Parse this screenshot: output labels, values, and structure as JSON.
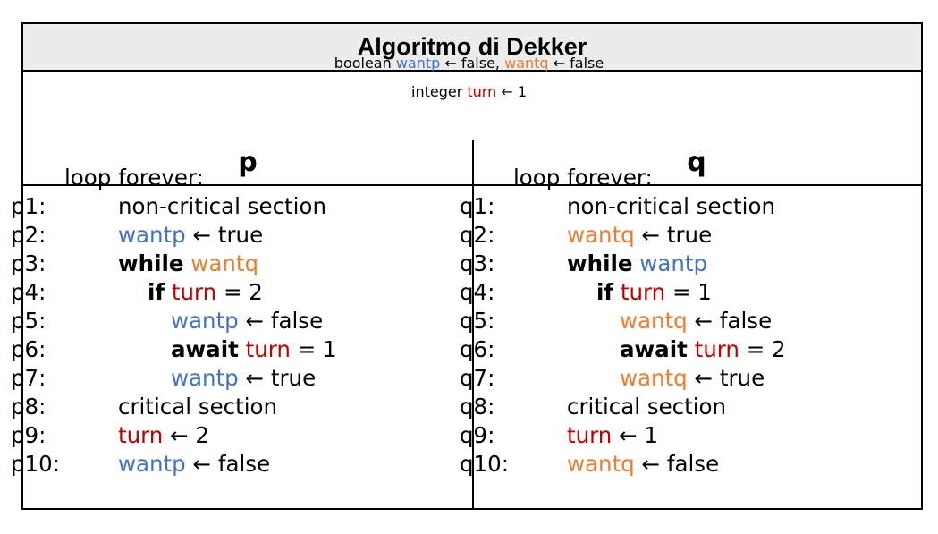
{
  "title": "Algoritmo di Dekker",
  "declarations": {
    "line1": {
      "kw": "boolean",
      "v1": "wantp",
      "a1": "← false,",
      "v2": "wantq",
      "a2": "← false"
    },
    "line2": {
      "kw": "integer",
      "v": "turn",
      "a": "← 1"
    }
  },
  "columns": {
    "p": {
      "header": "p",
      "loop": "loop forever:",
      "lines": [
        {
          "label": "p1:",
          "text": "non-critical section"
        },
        {
          "label": "p2:",
          "var": "wantp",
          "rest": "← true"
        },
        {
          "label": "p3:",
          "kw": "while",
          "var": "wantq"
        },
        {
          "label": "p4:",
          "kw": "if",
          "var": "turn",
          "rest": "= 2"
        },
        {
          "label": "p5:",
          "var": "wantp",
          "rest": "← false"
        },
        {
          "label": "p6:",
          "kw": "await",
          "var": "turn",
          "rest": "= 1"
        },
        {
          "label": "p7:",
          "var": "wantp",
          "rest": "← true"
        },
        {
          "label": "p8:",
          "text": "critical section"
        },
        {
          "label": "p9:",
          "var": "turn",
          "rest": "← 2"
        },
        {
          "label": "p10:",
          "var": "wantp",
          "rest": "← false"
        }
      ]
    },
    "q": {
      "header": "q",
      "loop": "loop forever:",
      "lines": [
        {
          "label": "q1:",
          "text": "non-critical section"
        },
        {
          "label": "q2:",
          "var": "wantq",
          "rest": "← true"
        },
        {
          "label": "q3:",
          "kw": "while",
          "var": "wantp"
        },
        {
          "label": "q4:",
          "kw": "if",
          "var": "turn",
          "rest": "= 1"
        },
        {
          "label": "q5:",
          "var": "wantq",
          "rest": "← false"
        },
        {
          "label": "q6:",
          "kw": "await",
          "var": "turn",
          "rest": "= 2"
        },
        {
          "label": "q7:",
          "var": "wantq",
          "rest": "← true"
        },
        {
          "label": "q8:",
          "text": "critical section"
        },
        {
          "label": "q9:",
          "var": "turn",
          "rest": "← 1"
        },
        {
          "label": "q10:",
          "var": "wantq",
          "rest": "← false"
        }
      ]
    }
  },
  "colors": {
    "wantp": "#4472c4",
    "wantq": "#ed7d31",
    "turn": "#c00000"
  }
}
